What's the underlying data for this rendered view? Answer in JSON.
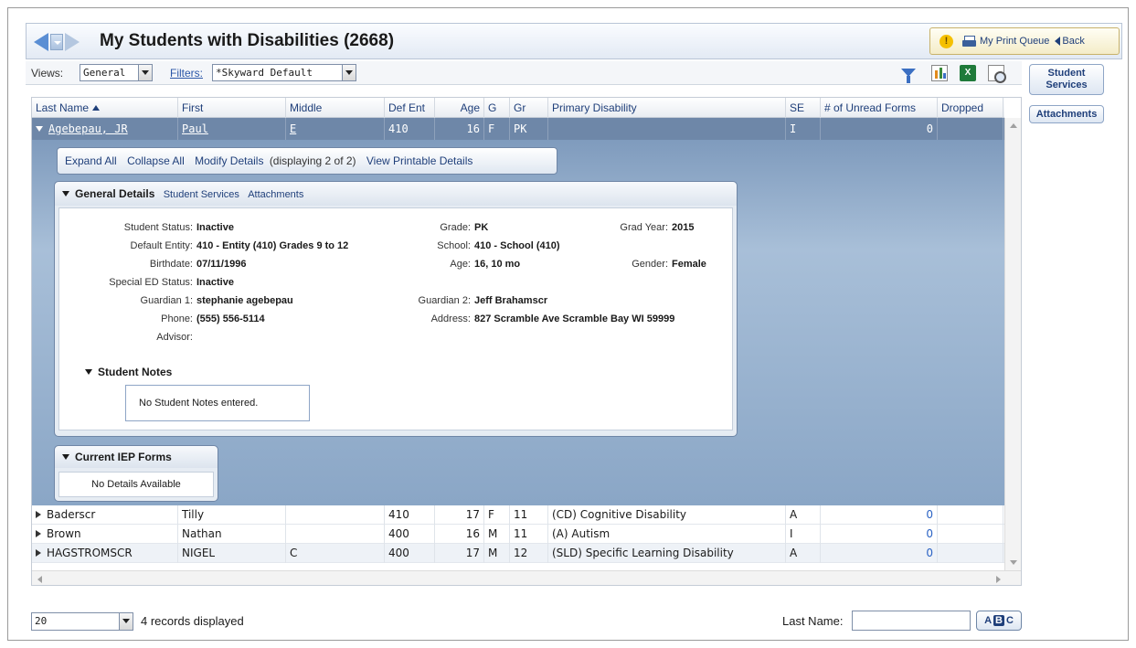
{
  "header": {
    "title": "My Students with Disabilities (2668)",
    "warn_glyph": "!",
    "print_queue": "My Print Queue",
    "back": "Back"
  },
  "toolbar": {
    "views_label": "Views:",
    "views_value": "General",
    "filters_label": "Filters:",
    "filters_value": "*Skyward Default",
    "excel_glyph": "X"
  },
  "side_buttons": {
    "student_services": "Student Services",
    "attachments": "Attachments"
  },
  "columns": {
    "last": "Last Name",
    "first": "First",
    "middle": "Middle",
    "defent": "Def Ent",
    "age": "Age",
    "g": "G",
    "gr": "Gr",
    "disability": "Primary Disability",
    "se": "SE",
    "unread": "# of Unread Forms",
    "dropped": "Dropped"
  },
  "selected_row": {
    "last": "Agebepau, JR",
    "first": "Paul",
    "middle": "E",
    "defent": "410",
    "age": "16",
    "g": "F",
    "gr": "PK",
    "disability": "",
    "se": "I",
    "unread": "0",
    "dropped": ""
  },
  "actions": {
    "expand_all": "Expand All",
    "collapse_all": "Collapse All",
    "modify_details": "Modify Details",
    "displaying": "(displaying 2 of 2)",
    "view_printable": "View Printable Details"
  },
  "general_details": {
    "title": "General Details",
    "link_services": "Student Services",
    "link_attachments": "Attachments",
    "fields": {
      "student_status": {
        "label": "Student Status:",
        "value": "Inactive"
      },
      "default_entity": {
        "label": "Default Entity:",
        "value": "410 - Entity (410) Grades 9 to 12"
      },
      "birthdate": {
        "label": "Birthdate:",
        "value": "07/11/1996"
      },
      "sped_status": {
        "label": "Special ED Status:",
        "value": "Inactive"
      },
      "guardian1": {
        "label": "Guardian 1:",
        "value": "stephanie agebepau"
      },
      "phone": {
        "label": "Phone:",
        "value": "(555) 556-5114"
      },
      "advisor": {
        "label": "Advisor:",
        "value": ""
      },
      "grade": {
        "label": "Grade:",
        "value": "PK"
      },
      "school": {
        "label": "School:",
        "value": "410 - School (410)"
      },
      "age": {
        "label": "Age:",
        "value": "16, 10 mo"
      },
      "guardian2": {
        "label": "Guardian 2:",
        "value": "Jeff Brahamscr"
      },
      "address": {
        "label": "Address:",
        "value": "827 Scramble Ave Scramble Bay WI 59999"
      },
      "grad_year": {
        "label": "Grad Year:",
        "value": "2015"
      },
      "gender": {
        "label": "Gender:",
        "value": "Female"
      }
    },
    "notes_title": "Student Notes",
    "notes_empty": "No Student Notes entered."
  },
  "iep": {
    "title": "Current IEP Forms",
    "empty": "No Details Available"
  },
  "rows": [
    {
      "last": "Baderscr",
      "first": "Tilly",
      "middle": "",
      "defent": "410",
      "age": "17",
      "g": "F",
      "gr": "11",
      "disability": "(CD) Cognitive Disability",
      "se": "A",
      "unread": "0",
      "dropped": ""
    },
    {
      "last": "Brown",
      "first": "Nathan",
      "middle": "",
      "defent": "400",
      "age": "16",
      "g": "M",
      "gr": "11",
      "disability": "(A) Autism",
      "se": "I",
      "unread": "0",
      "dropped": ""
    },
    {
      "last": "HAGSTROMSCR",
      "first": "NIGEL",
      "middle": "C",
      "defent": "400",
      "age": "17",
      "g": "M",
      "gr": "12",
      "disability": "(SLD) Specific Learning Disability",
      "se": "A",
      "unread": "0",
      "dropped": ""
    }
  ],
  "footer": {
    "page_size": "20",
    "records": "4 records displayed",
    "last_name_label": "Last Name:",
    "last_name_value": "",
    "abc_a": "A",
    "abc_b": "B",
    "abc_c": "C"
  },
  "colors": {
    "selected_row": "#6e87a8",
    "link": "#2a56a8",
    "header_text": "#1f3f7a"
  }
}
